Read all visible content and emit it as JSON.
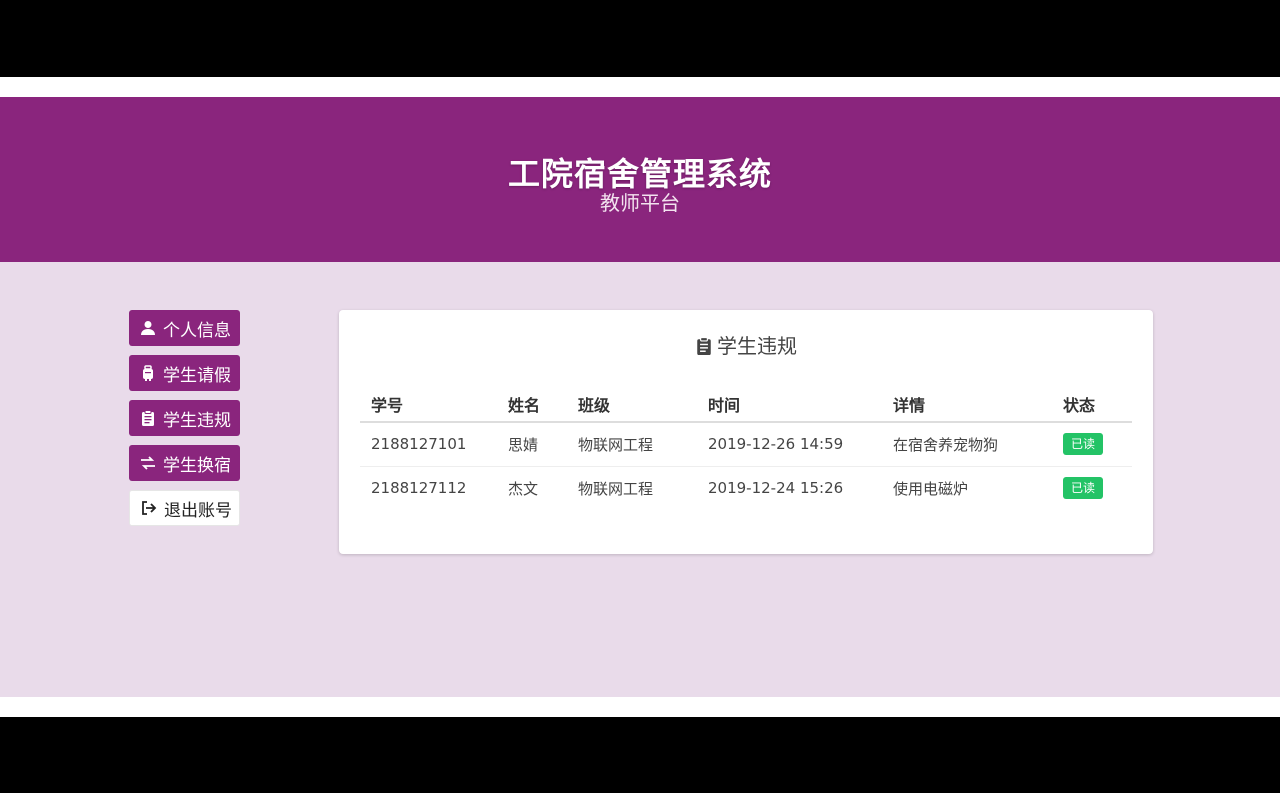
{
  "header": {
    "title": "工院宿舍管理系统",
    "subtitle": "教师平台"
  },
  "sidebar": {
    "items": [
      {
        "label": "个人信息",
        "icon": "user-icon"
      },
      {
        "label": "学生请假",
        "icon": "suitcase-icon"
      },
      {
        "label": "学生违规",
        "icon": "clipboard-icon"
      },
      {
        "label": "学生换宿",
        "icon": "exchange-icon"
      },
      {
        "label": "退出账号",
        "icon": "sign-out-icon"
      }
    ]
  },
  "panel": {
    "title": "学生违规",
    "icon": "clipboard-icon",
    "columns": [
      "学号",
      "姓名",
      "班级",
      "时间",
      "详情",
      "状态"
    ],
    "rows": [
      {
        "id": "2188127101",
        "name": "思婧",
        "class": "物联网工程",
        "time": "2019-12-26 14:59",
        "detail": "在宿舍养宠物狗",
        "status": "已读"
      },
      {
        "id": "2188127112",
        "name": "杰文",
        "class": "物联网工程",
        "time": "2019-12-24 15:26",
        "detail": "使用电磁炉",
        "status": "已读"
      }
    ]
  },
  "colors": {
    "brand": "#8a257d",
    "background": "#e9dbea",
    "status_read": "#23c366"
  }
}
